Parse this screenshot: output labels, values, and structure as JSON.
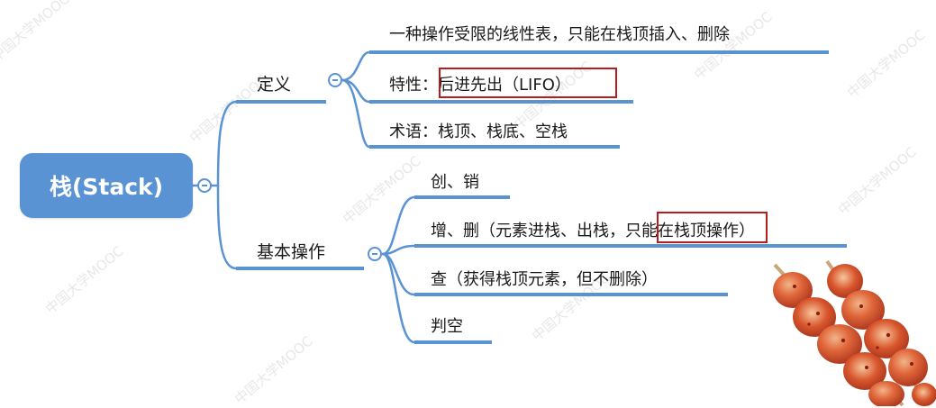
{
  "root": {
    "label": "栈(Stack)"
  },
  "branches": [
    {
      "label": "定义",
      "items": [
        "一种操作受限的线性表，只能在栈顶插入、删除",
        "特性：后进先出（LIFO）",
        "术语：栈顶、栈底、空栈"
      ]
    },
    {
      "label": "基本操作",
      "items": [
        "创、销",
        "增、删（元素进栈、出栈，只能在栈顶操作）",
        "查（获得栈顶元素，但不删除）",
        "判空"
      ]
    }
  ],
  "watermark": "中国大学MOOC",
  "colors": {
    "connector": "#5a93d3",
    "node_fill": "#5a93d3",
    "highlight_box": "#b71c1c"
  },
  "decorations": {
    "image": "grilled-meat-skewers-image"
  }
}
